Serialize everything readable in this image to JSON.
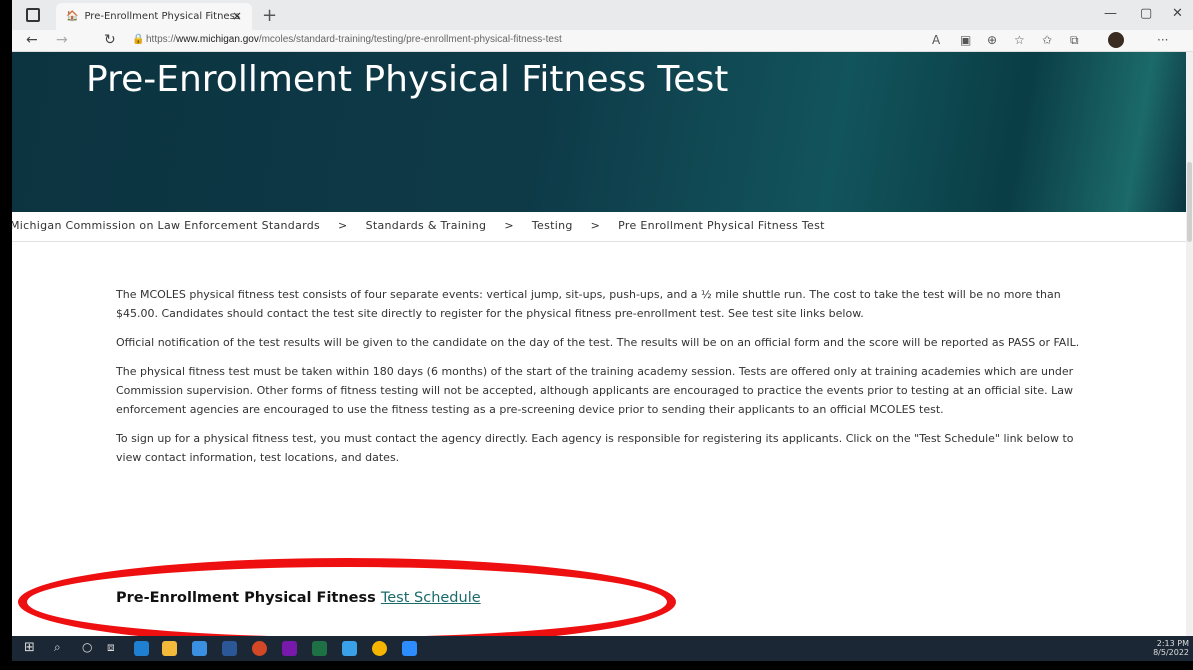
{
  "browser": {
    "tab_title": "Pre-Enrollment Physical Fitness",
    "tab_close": "×",
    "new_tab": "+",
    "url_prefix": "https://",
    "url_host": "www.michigan.gov",
    "url_path": "/mcoles/standard-training/testing/pre-enrollment-physical-fitness-test",
    "more_menu": "···"
  },
  "page": {
    "title": "Pre-Enrollment Physical Fitness Test",
    "breadcrumb": [
      "Michigan Commission on Law Enforcement Standards",
      "Standards & Training",
      "Testing",
      "Pre Enrollment Physical Fitness Test"
    ],
    "breadcrumb_sep": ">",
    "paragraphs": [
      "The MCOLES physical fitness test consists of four separate events: vertical jump, sit-ups, push-ups, and a ½ mile shuttle run. The cost to take the test will be no more than $45.00. Candidates should contact the test site directly to register for the physical fitness pre-enrollment test. See test site links below.",
      "Official notification of the test results will be given to the candidate on the day of the test. The results will be on an official form and the score will be reported as PASS or FAIL.",
      "The physical fitness test must be taken within 180 days (6 months) of the start of the training academy session. Tests are offered only at training academies which are under Commission supervision. Other forms of fitness testing will not be accepted, although applicants are encouraged to practice the events prior to testing at an official site. Law enforcement agencies are encouraged to use the fitness testing as a pre-screening device prior to sending their applicants to an official MCOLES test.",
      "To sign up for a physical fitness test, you must contact the agency directly. Each agency is responsible for registering its applicants. Click on the \"Test Schedule\" link below to view contact information, test locations, and dates."
    ],
    "schedule_heading": "Pre-Enrollment Physical Fitness",
    "schedule_link": "Test Schedule"
  },
  "taskbar": {
    "time": "2:13 PM",
    "date": "8/5/2022"
  },
  "colors": {
    "hero_bg": "#0e3a48",
    "link": "#1a6b6b",
    "annotation": "#ee1010",
    "taskbar_bg": "#1c2735"
  }
}
